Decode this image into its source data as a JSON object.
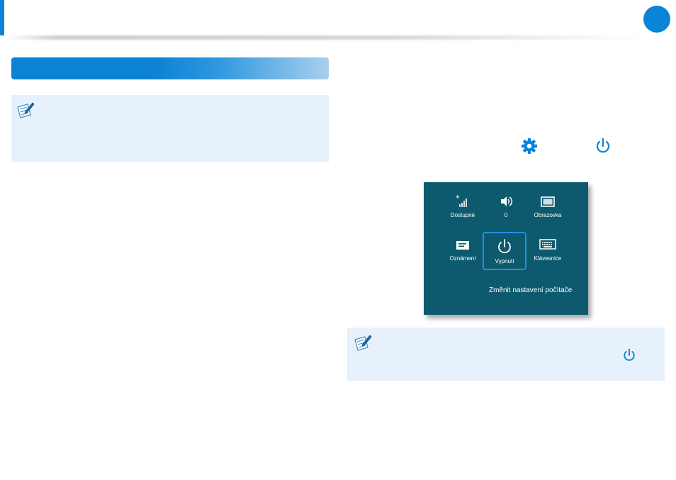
{
  "colors": {
    "accent": "#0a84d8",
    "panel_bg": "#0d5a6e",
    "note_bg": "#e7f1fb"
  },
  "charms_panel": {
    "tiles": [
      {
        "label": "Dostupné",
        "icon": "network-signal-icon"
      },
      {
        "label": "0",
        "icon": "speaker-volume-icon"
      },
      {
        "label": "Obrazovka",
        "icon": "screen-brightness-icon"
      },
      {
        "label": "Oznámení",
        "icon": "notifications-icon"
      },
      {
        "label": "Vypnutí",
        "icon": "power-icon",
        "selected": true
      },
      {
        "label": "Klávesnice",
        "icon": "keyboard-icon"
      }
    ],
    "settings_link": "Změnit nastavení počítače"
  },
  "icons": [
    "pencil-note-icon",
    "gear-icon",
    "power-icon"
  ]
}
